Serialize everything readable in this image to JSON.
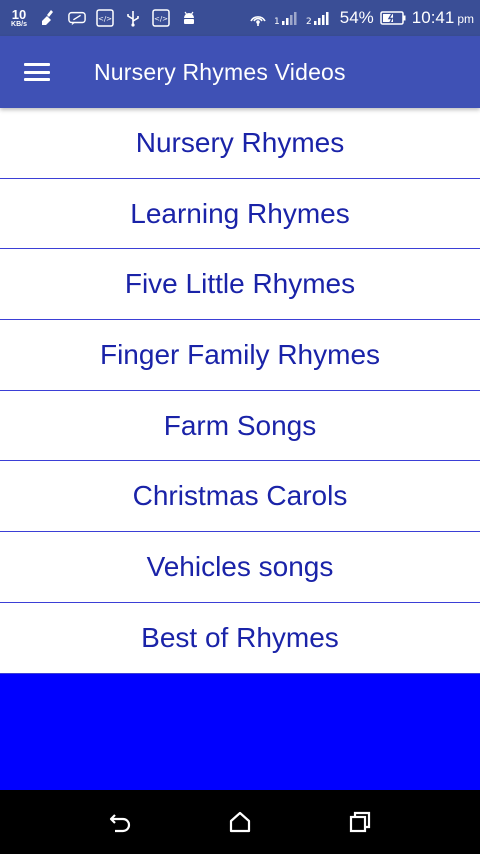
{
  "status_bar": {
    "net_speed_value": "10",
    "net_speed_unit": "KB/s",
    "battery": "54%",
    "time": "10:41",
    "ampm": "pm",
    "icons": [
      "broom-icon",
      "message-icon",
      "code-icon",
      "usb-icon",
      "code-icon",
      "android-icon",
      "hotspot-icon",
      "signal-icon",
      "signal-icon",
      "battery-icon"
    ]
  },
  "app_bar": {
    "title": "Nursery Rhymes Videos",
    "menu_icon": "hamburger-menu-icon"
  },
  "categories": [
    {
      "label": "Nursery Rhymes"
    },
    {
      "label": "Learning Rhymes"
    },
    {
      "label": "Five Little Rhymes"
    },
    {
      "label": "Finger Family Rhymes"
    },
    {
      "label": "Farm Songs"
    },
    {
      "label": "Christmas Carols"
    },
    {
      "label": "Vehicles songs"
    },
    {
      "label": "Best of Rhymes"
    }
  ],
  "colors": {
    "status_bar": "#3a4e96",
    "app_bar": "#3f51b5",
    "item_text": "#1a23a8",
    "divider": "#3b3fd6",
    "ad_area": "#0000ff",
    "nav_bar": "#000000"
  },
  "nav_bar": {
    "buttons": [
      "back-icon",
      "home-icon",
      "recents-icon"
    ]
  }
}
